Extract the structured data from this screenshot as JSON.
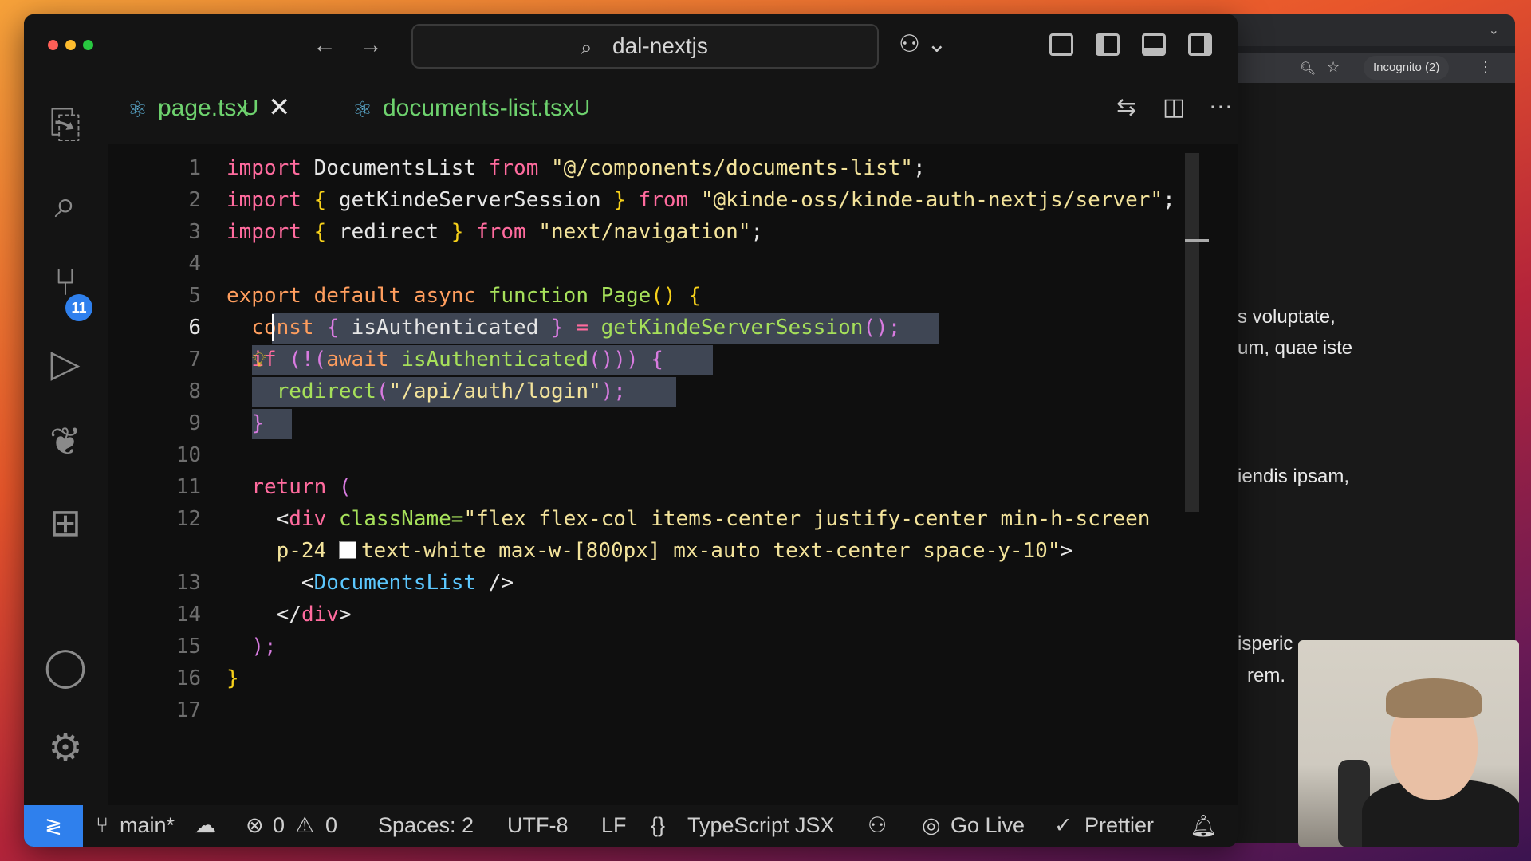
{
  "window": {
    "search_icon": "search-icon",
    "title": "dal-nextjs"
  },
  "tabs": [
    {
      "label": "page.tsx",
      "status": "U",
      "active": true
    },
    {
      "label": "documents-list.tsx",
      "status": "U",
      "active": false
    }
  ],
  "activity_bar": {
    "source_control_badge": "11"
  },
  "editor": {
    "line_numbers": [
      "1",
      "2",
      "3",
      "4",
      "5",
      "6",
      "7",
      "8",
      "9",
      "10",
      "11",
      "12",
      "13",
      "14",
      "15",
      "16",
      "17"
    ],
    "current_line": "6",
    "lines": {
      "l1": {
        "a": "import",
        "b": "DocumentsList",
        "c": "from",
        "d": "\"@/components/documents-list\"",
        "e": ";"
      },
      "l2": {
        "a": "import",
        "b": "{",
        "c": "getKindeServerSession",
        "d": "}",
        "e": "from",
        "f": "\"@kinde-oss/kinde-auth-nextjs/server\"",
        "g": ";"
      },
      "l3": {
        "a": "import",
        "b": "{",
        "c": "redirect",
        "d": "}",
        "e": "from",
        "f": "\"next/navigation\"",
        "g": ";"
      },
      "l5": {
        "a": "export",
        "b": "default",
        "c": "async",
        "d": "function",
        "e": "Page",
        "f": "()",
        "g": "{"
      },
      "l6": {
        "a": "const",
        "b": "{",
        "c": "isAuthenticated",
        "d": "}",
        "e": "=",
        "f": "getKindeServerSession",
        "g": "();"
      },
      "l7": {
        "a": "if",
        "b": "(!(",
        "c": "await",
        "d": "isAuthenticated",
        "e": "()))",
        "f": "{"
      },
      "l8": {
        "a": "redirect",
        "b": "(",
        "c": "\"/api/auth/login\"",
        "d": ");"
      },
      "l9": {
        "a": "}"
      },
      "l11": {
        "a": "return",
        "b": "("
      },
      "l12": {
        "a": "<",
        "b": "div",
        "c": "className=",
        "d": "\"flex flex-col items-center justify-center min-h-screen"
      },
      "l12b": {
        "a": "p-24",
        "b": "text-white max-w-[800px] mx-auto text-center space-y-10\"",
        "c": ">"
      },
      "l13": {
        "a": "<",
        "b": "DocumentsList",
        "c": "/>"
      },
      "l14": {
        "a": "</",
        "b": "div",
        "c": ">"
      },
      "l15": {
        "a": ");"
      },
      "l16": {
        "a": "}"
      }
    }
  },
  "statusbar": {
    "branch": "main*",
    "errors": "0",
    "warnings": "0",
    "spaces": "Spaces: 2",
    "encoding": "UTF-8",
    "eol": "LF",
    "braces": "{}",
    "language": "TypeScript JSX",
    "go_live": "Go Live",
    "prettier": "Prettier"
  },
  "browser": {
    "incognito": "Incognito (2)",
    "text_lines": [
      "s voluptate,",
      "um, quae iste",
      "iendis ipsam,",
      "isperic",
      "rem."
    ]
  },
  "colors": {
    "accent": "#2f80ed",
    "keyword": "#ff6b9e",
    "function": "#a6e05a",
    "string": "#f3e39b",
    "selection": "#3f4654",
    "modified_tab": "#6ed26e"
  }
}
